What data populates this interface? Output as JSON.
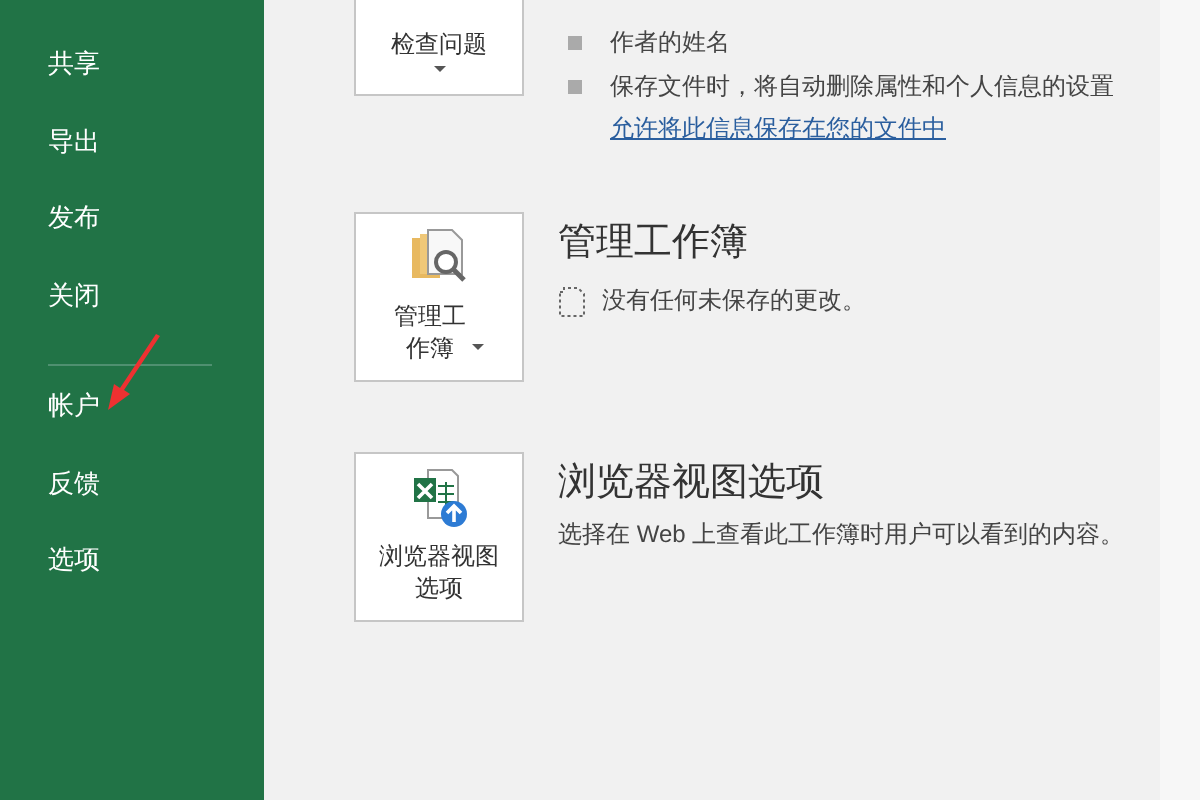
{
  "sidebar": {
    "groups": [
      {
        "items": [
          {
            "label": "共享"
          },
          {
            "label": "导出"
          },
          {
            "label": "发布"
          },
          {
            "label": "关闭"
          }
        ]
      },
      {
        "items": [
          {
            "label": "帐户"
          },
          {
            "label": "反馈"
          },
          {
            "label": "选项"
          }
        ]
      }
    ]
  },
  "sections": [
    {
      "kind": "inspect",
      "button_lines": [
        "检查问题"
      ],
      "dropdown": true,
      "bullets": [
        "作者的姓名",
        "保存文件时，将自动删除属性和个人信息的设置"
      ],
      "link": "允许将此信息保存在您的文件中"
    },
    {
      "kind": "manage",
      "button_lines": [
        "管理工",
        "作簿"
      ],
      "dropdown": true,
      "title": "管理工作簿",
      "note": "没有任何未保存的更改。"
    },
    {
      "kind": "browser",
      "button_lines": [
        "浏览器视图",
        "选项"
      ],
      "dropdown": false,
      "title": "浏览器视图选项",
      "description": "选择在 Web 上查看此工作簿时用户可以看到的内容。"
    }
  ]
}
